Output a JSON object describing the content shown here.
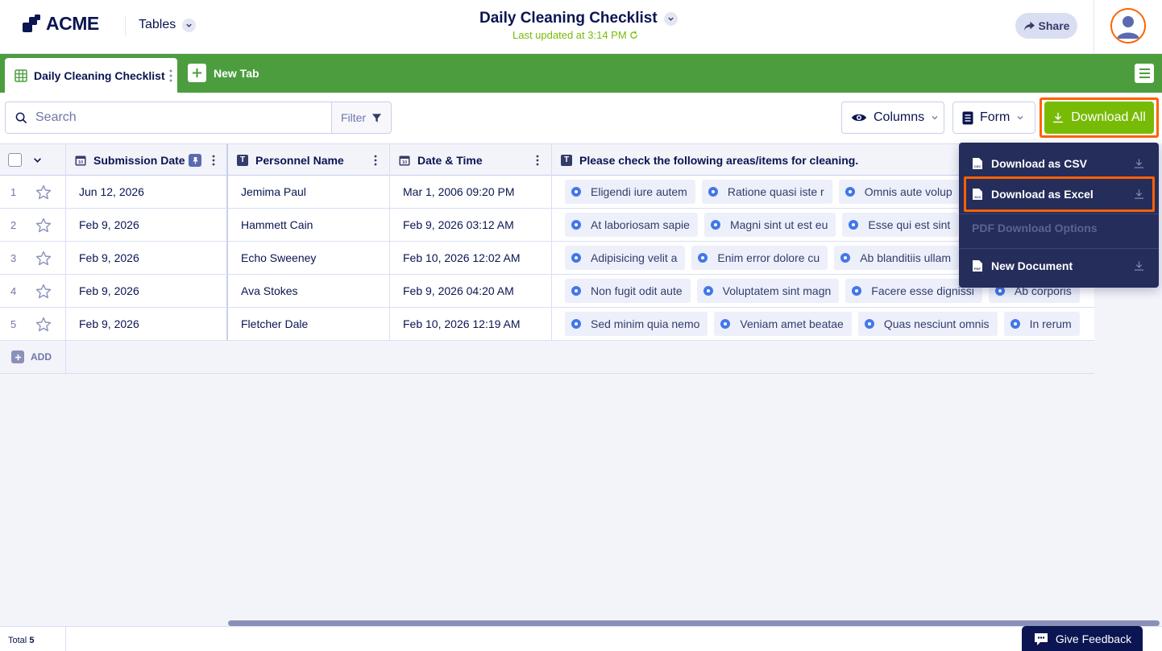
{
  "header": {
    "logo_text": "ACME",
    "app_switch_label": "Tables",
    "doc_title": "Daily Cleaning Checklist",
    "last_updated": "Last updated at 3:14 PM",
    "share_label": "Share"
  },
  "tabs": {
    "active_tab": "Daily Cleaning Checklist",
    "new_tab_label": "New Tab"
  },
  "toolbar": {
    "search_placeholder": "Search",
    "filter_label": "Filter",
    "columns_label": "Columns",
    "form_label": "Form",
    "download_all_label": "Download All"
  },
  "table": {
    "columns": [
      "Submission Date",
      "Personnel Name",
      "Date & Time",
      "Please check the following areas/items for cleaning."
    ],
    "rows": [
      {
        "num": "1",
        "submission_date": "Jun 12, 2026",
        "name": "Jemima Paul",
        "datetime": "Mar 1, 2006 09:20 PM",
        "tags": [
          "Eligendi iure autem",
          "Ratione quasi iste r",
          "Omnis aute volup"
        ]
      },
      {
        "num": "2",
        "submission_date": "Feb 9, 2026",
        "name": "Hammett Cain",
        "datetime": "Feb 9, 2026 03:12 AM",
        "tags": [
          "At laboriosam sapie",
          "Magni sint ut est eu",
          "Esse qui est sint"
        ]
      },
      {
        "num": "3",
        "submission_date": "Feb 9, 2026",
        "name": "Echo Sweeney",
        "datetime": "Feb 10, 2026 12:02 AM",
        "tags": [
          "Adipisicing velit a",
          "Enim error dolore cu",
          "Ab blanditiis ullam"
        ]
      },
      {
        "num": "4",
        "submission_date": "Feb 9, 2026",
        "name": "Ava Stokes",
        "datetime": "Feb 9, 2026 04:20 AM",
        "tags": [
          "Non fugit odit aute",
          "Voluptatem sint magn",
          "Facere esse dignissi",
          "Ab corporis"
        ]
      },
      {
        "num": "5",
        "submission_date": "Feb 9, 2026",
        "name": "Fletcher Dale",
        "datetime": "Feb 10, 2026 12:19 AM",
        "tags": [
          "Sed minim quia nemo",
          "Veniam amet beatae",
          "Quas nesciunt omnis",
          "In rerum"
        ]
      }
    ],
    "add_label": "ADD"
  },
  "download_menu": {
    "csv_label": "Download as CSV",
    "excel_label": "Download as Excel",
    "pdf_options_label": "PDF Download Options",
    "new_document_label": "New Document"
  },
  "footer": {
    "total_label": "Total",
    "total_count": "5",
    "feedback_label": "Give Feedback"
  },
  "colors": {
    "brand_green": "#4c9d3e",
    "download_green": "#78bb07",
    "navy": "#0a1551",
    "highlight_orange": "#ff6100",
    "tag_blue": "#4277e9"
  },
  "icons": {
    "logo": "acme-logo-icon",
    "tab": "table-grid-icon",
    "search": "search-icon",
    "filter": "filter-funnel-icon",
    "columns": "eye-icon",
    "form": "form-document-icon",
    "download": "download-icon",
    "share": "share-arrow-icon",
    "feedback": "feedback-chat-icon"
  }
}
